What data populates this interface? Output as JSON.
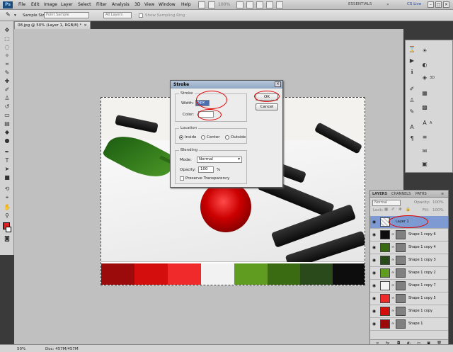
{
  "menubar": {
    "logo": "Ps",
    "items": [
      "File",
      "Edit",
      "Image",
      "Layer",
      "Select",
      "Filter",
      "Analysis",
      "3D",
      "View",
      "Window",
      "Help"
    ],
    "zoom": "100%",
    "essentials": "ESSENTIALS",
    "cs_live": "CS Live"
  },
  "options": {
    "sample_size_label": "Sample Size:",
    "sample_size_value": "Point Sample",
    "sample_value": "All Layers",
    "show_ring_label": "Show Sampling Ring"
  },
  "document": {
    "tab_title": "08.jpg @ 50% (Layer 1, RGB/8) *",
    "close": "×"
  },
  "status": {
    "zoom": "50%",
    "doc": "Doc: 457M/457M"
  },
  "colors": {
    "foreground": "#e02020",
    "background": "#ffffff",
    "swatches": [
      "#9b0b0b",
      "#d40d0d",
      "#f02a2a",
      "#f2f2f2",
      "#5f9c1f",
      "#3a6b12",
      "#2b4a1c",
      "#0d0d0d"
    ]
  },
  "dialog": {
    "title": "Stroke",
    "stroke_group": "Stroke",
    "width_label": "Width:",
    "width_value": "5px",
    "color_label": "Color:",
    "location_group": "Location",
    "loc_inside": "Inside",
    "loc_center": "Center",
    "loc_outside": "Outside",
    "blending_group": "Blending",
    "mode_label": "Mode:",
    "mode_value": "Normal",
    "opacity_label": "Opacity:",
    "opacity_value": "100",
    "opacity_unit": "%",
    "preserve_label": "Preserve Transparency",
    "ok_label": "OK",
    "cancel_label": "Cancel"
  },
  "dock": {
    "items": [
      "",
      "",
      "",
      "",
      "3D",
      "",
      "",
      "",
      "",
      "A",
      "",
      "",
      "",
      ""
    ]
  },
  "layers": {
    "tabs": [
      "LAYERS",
      "CHANNELS",
      "PATHS"
    ],
    "blend_mode": "Normal",
    "opacity_label": "Opacity:",
    "opacity": "100%",
    "lock_label": "Lock:",
    "fill_label": "Fill:",
    "fill": "100%",
    "rows": [
      {
        "name": "Layer 1",
        "thumb": "#ffffff",
        "selected": true
      },
      {
        "name": "Shape 1 copy 6",
        "thumb": "#0d0d0d"
      },
      {
        "name": "Shape 1 copy 4",
        "thumb": "#3a6b12"
      },
      {
        "name": "Shape 1 copy 3",
        "thumb": "#2b4a1c"
      },
      {
        "name": "Shape 1 copy 2",
        "thumb": "#5f9c1f"
      },
      {
        "name": "Shape 1 copy 7",
        "thumb": "#f2f2f2"
      },
      {
        "name": "Shape 1 copy 5",
        "thumb": "#f02a2a"
      },
      {
        "name": "Shape 1 copy",
        "thumb": "#d40d0d"
      },
      {
        "name": "Shape 1",
        "thumb": "#9b0b0b"
      }
    ]
  }
}
